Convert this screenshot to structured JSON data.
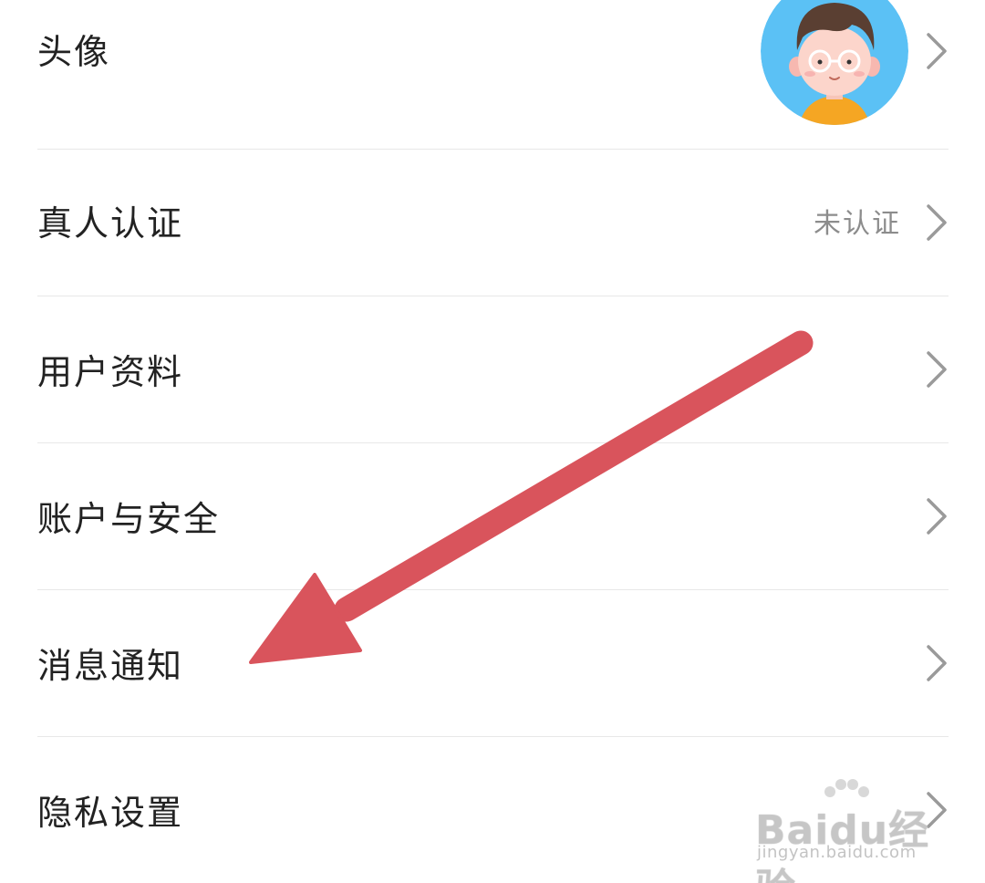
{
  "settings": {
    "items": [
      {
        "label": "头像",
        "value": ""
      },
      {
        "label": "真人认证",
        "value": "未认证"
      },
      {
        "label": "用户资料",
        "value": ""
      },
      {
        "label": "账户与安全",
        "value": ""
      },
      {
        "label": "消息通知",
        "value": ""
      },
      {
        "label": "隐私设置",
        "value": ""
      }
    ]
  },
  "annotation": {
    "arrow_color": "#d9545c"
  },
  "watermark": {
    "brand": "Baidu经验",
    "url": "jingyan.baidu.com"
  },
  "icons": {
    "chevron": "chevron-right-icon",
    "avatar": "cartoon-avatar-icon"
  },
  "colors": {
    "avatar_bg": "#5bc1f5",
    "divider": "#e8e8e8",
    "label": "#222222",
    "value": "#8c8c8c"
  }
}
